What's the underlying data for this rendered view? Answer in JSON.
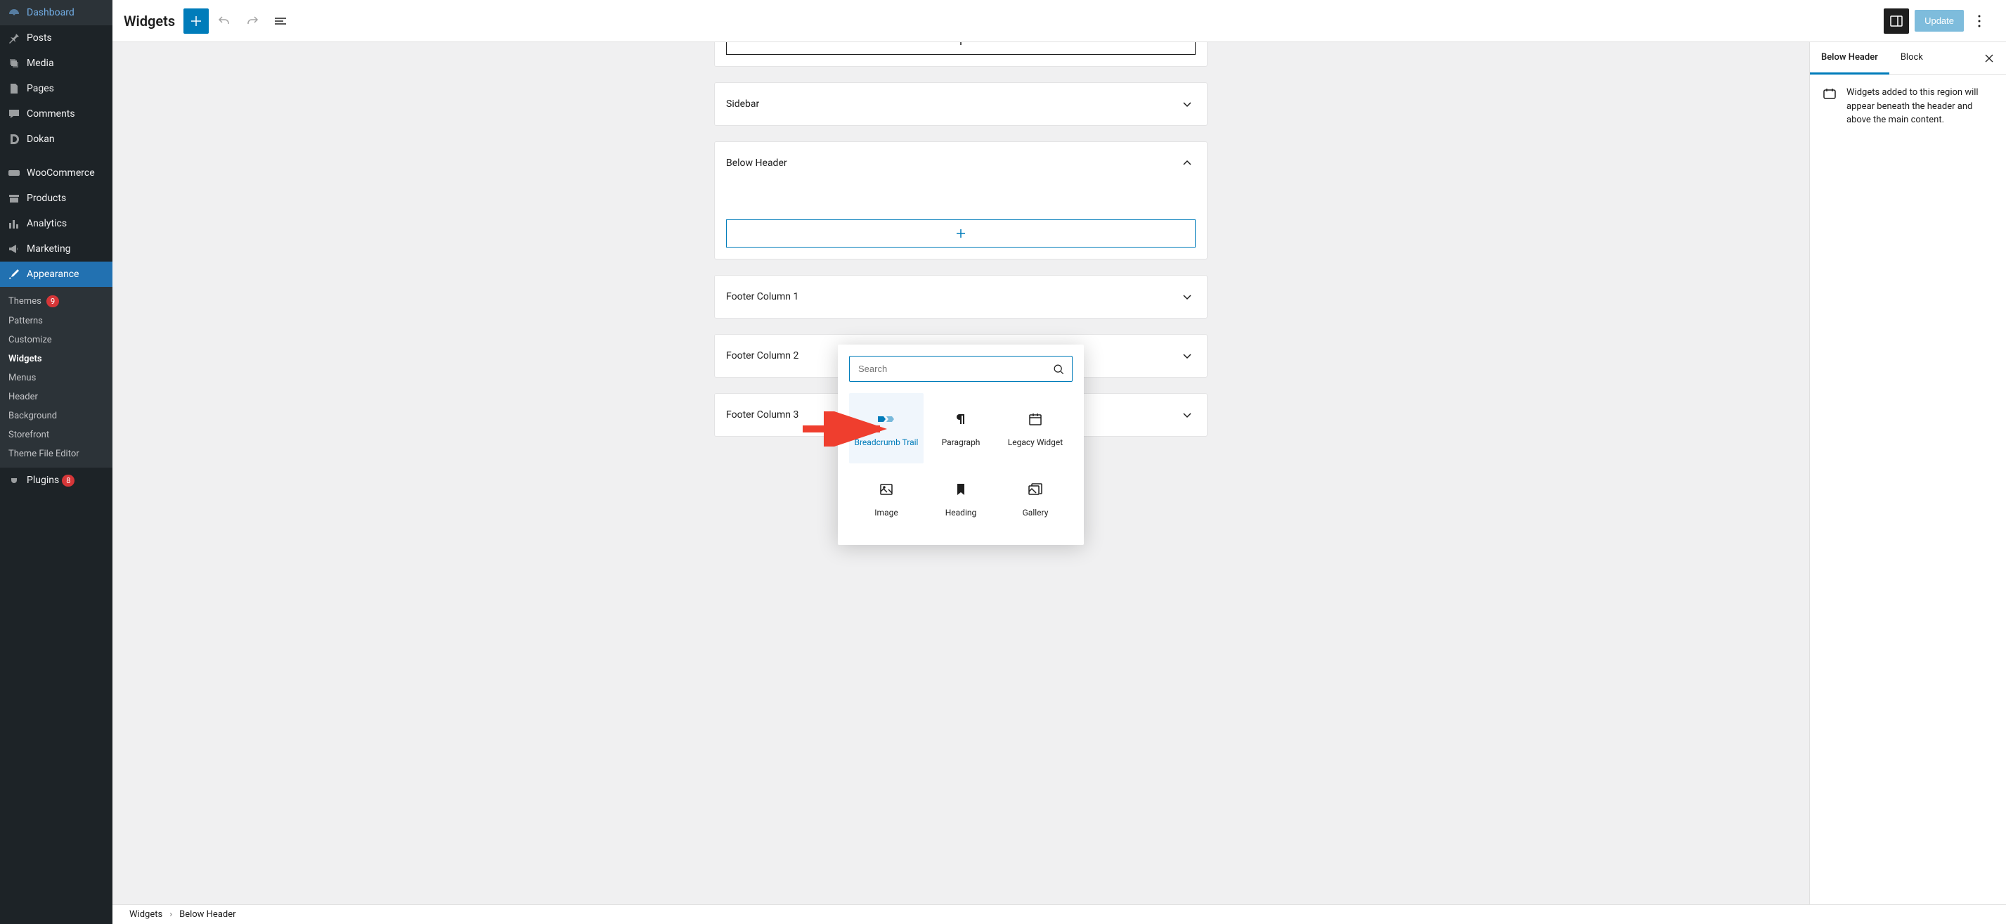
{
  "colors": {
    "accent": "#007cba",
    "danger": "#d63638"
  },
  "admin_menu": {
    "items": [
      {
        "label": "Dashboard",
        "icon": "dashboard"
      },
      {
        "label": "Posts",
        "icon": "pin"
      },
      {
        "label": "Media",
        "icon": "media"
      },
      {
        "label": "Pages",
        "icon": "page"
      },
      {
        "label": "Comments",
        "icon": "comment"
      },
      {
        "label": "Dokan",
        "icon": "dokan"
      },
      {
        "label": "WooCommerce",
        "icon": "woo"
      },
      {
        "label": "Products",
        "icon": "archive"
      },
      {
        "label": "Analytics",
        "icon": "chart"
      },
      {
        "label": "Marketing",
        "icon": "megaphone"
      },
      {
        "label": "Appearance",
        "icon": "brush",
        "active": true
      },
      {
        "label": "Plugins",
        "icon": "plug",
        "badge": "8"
      }
    ],
    "submenu": [
      {
        "label": "Themes",
        "badge": "9"
      },
      {
        "label": "Patterns"
      },
      {
        "label": "Customize"
      },
      {
        "label": "Widgets",
        "current": true
      },
      {
        "label": "Menus"
      },
      {
        "label": "Header"
      },
      {
        "label": "Background"
      },
      {
        "label": "Storefront"
      },
      {
        "label": "Theme File Editor"
      }
    ]
  },
  "topbar": {
    "title": "Widgets",
    "update_label": "Update"
  },
  "widget_areas": [
    {
      "name": "Sidebar",
      "expanded": false
    },
    {
      "name": "Below Header",
      "expanded": true
    },
    {
      "name": "Footer Column 1",
      "expanded": false
    },
    {
      "name": "Footer Column 2",
      "expanded": false
    },
    {
      "name": "Footer Column 3",
      "expanded": false
    }
  ],
  "inserter": {
    "search_placeholder": "Search",
    "blocks": [
      {
        "label": "Breadcrumb Trail",
        "icon": "breadcrumb",
        "selected": true
      },
      {
        "label": "Paragraph",
        "icon": "paragraph"
      },
      {
        "label": "Legacy Widget",
        "icon": "calendar"
      },
      {
        "label": "Image",
        "icon": "image"
      },
      {
        "label": "Heading",
        "icon": "bookmark"
      },
      {
        "label": "Gallery",
        "icon": "gallery"
      }
    ]
  },
  "settings": {
    "tabs": [
      "Below Header",
      "Block"
    ],
    "active_tab": 0,
    "description": "Widgets added to this region will appear beneath the header and above the main content."
  },
  "breadcrumb": {
    "root": "Widgets",
    "current": "Below Header"
  }
}
